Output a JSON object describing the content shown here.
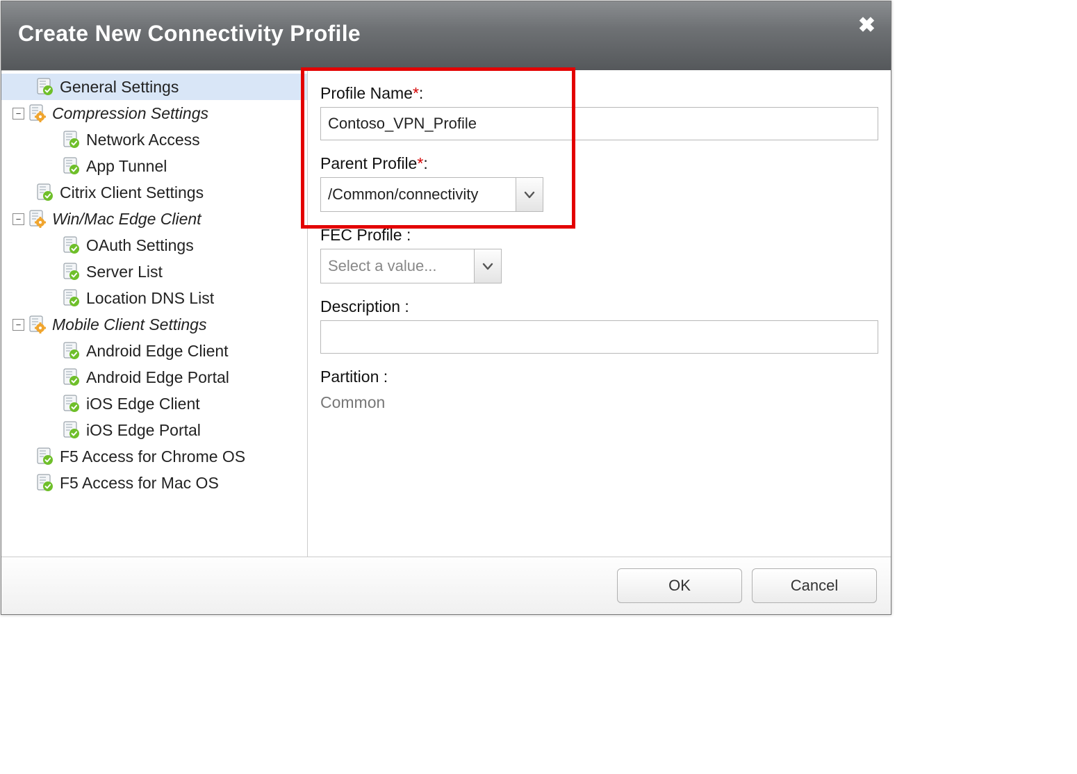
{
  "dialog": {
    "title": "Create New Connectivity Profile"
  },
  "sidebar": {
    "items": [
      {
        "id": "general-settings",
        "label": "General Settings",
        "indent": 1,
        "icon": "page-check",
        "expander": null,
        "italic": false,
        "selected": true
      },
      {
        "id": "compression-settings",
        "label": "Compression Settings",
        "indent": 0,
        "icon": "page-gear",
        "expander": "−",
        "italic": true,
        "selected": false
      },
      {
        "id": "network-access",
        "label": "Network Access",
        "indent": 2,
        "icon": "page-check",
        "expander": null,
        "italic": false,
        "selected": false
      },
      {
        "id": "app-tunnel",
        "label": "App Tunnel",
        "indent": 2,
        "icon": "page-check",
        "expander": null,
        "italic": false,
        "selected": false
      },
      {
        "id": "citrix-client",
        "label": "Citrix Client Settings",
        "indent": 1,
        "icon": "page-check",
        "expander": null,
        "italic": false,
        "selected": false
      },
      {
        "id": "winmac-edge",
        "label": "Win/Mac Edge Client",
        "indent": 0,
        "icon": "page-gear",
        "expander": "−",
        "italic": true,
        "selected": false
      },
      {
        "id": "oauth-settings",
        "label": "OAuth Settings",
        "indent": 2,
        "icon": "page-check",
        "expander": null,
        "italic": false,
        "selected": false
      },
      {
        "id": "server-list",
        "label": "Server List",
        "indent": 2,
        "icon": "page-check",
        "expander": null,
        "italic": false,
        "selected": false
      },
      {
        "id": "location-dns",
        "label": "Location DNS List",
        "indent": 2,
        "icon": "page-check",
        "expander": null,
        "italic": false,
        "selected": false
      },
      {
        "id": "mobile-client",
        "label": "Mobile Client Settings",
        "indent": 0,
        "icon": "page-gear",
        "expander": "−",
        "italic": true,
        "selected": false
      },
      {
        "id": "android-edge-client",
        "label": "Android Edge Client",
        "indent": 2,
        "icon": "page-check",
        "expander": null,
        "italic": false,
        "selected": false
      },
      {
        "id": "android-edge-portal",
        "label": "Android Edge Portal",
        "indent": 2,
        "icon": "page-check",
        "expander": null,
        "italic": false,
        "selected": false
      },
      {
        "id": "ios-edge-client",
        "label": "iOS Edge Client",
        "indent": 2,
        "icon": "page-check",
        "expander": null,
        "italic": false,
        "selected": false
      },
      {
        "id": "ios-edge-portal",
        "label": "iOS Edge Portal",
        "indent": 2,
        "icon": "page-check",
        "expander": null,
        "italic": false,
        "selected": false
      },
      {
        "id": "f5-chrome",
        "label": "F5 Access for Chrome OS",
        "indent": 1,
        "icon": "page-check",
        "expander": null,
        "italic": false,
        "selected": false
      },
      {
        "id": "f5-mac",
        "label": "F5 Access for Mac OS",
        "indent": 1,
        "icon": "page-check",
        "expander": null,
        "italic": false,
        "selected": false
      }
    ]
  },
  "form": {
    "profile_name": {
      "label": "Profile Name",
      "required": true,
      "value": "Contoso_VPN_Profile"
    },
    "parent_profile": {
      "label": "Parent Profile",
      "required": true,
      "value": "/Common/connectivity"
    },
    "fec_profile": {
      "label": "FEC Profile",
      "required": false,
      "value": "",
      "placeholder": "Select a value..."
    },
    "description": {
      "label": "Description",
      "required": false,
      "value": ""
    },
    "partition": {
      "label": "Partition",
      "required": false,
      "value": "Common"
    }
  },
  "footer": {
    "ok": "OK",
    "cancel": "Cancel"
  }
}
